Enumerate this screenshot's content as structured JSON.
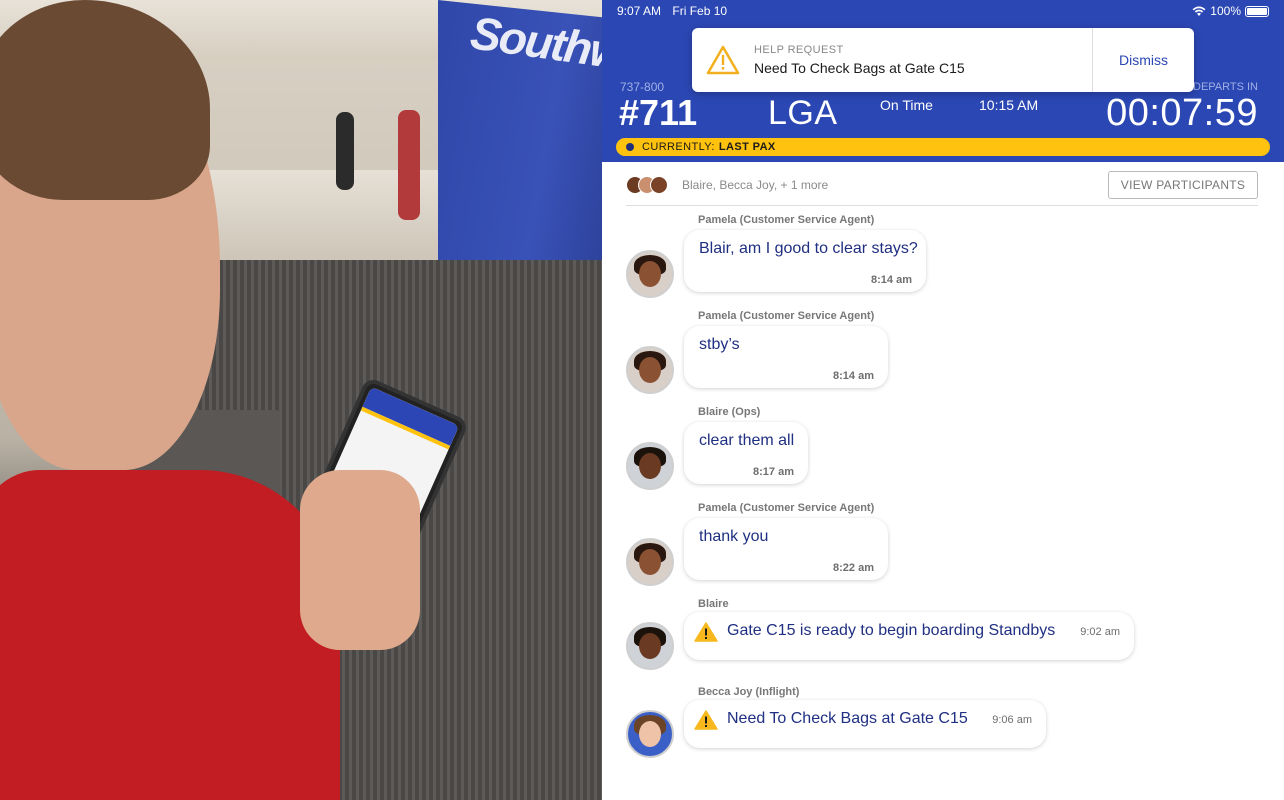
{
  "status_bar": {
    "time": "9:07 AM",
    "date": "Fri Feb 10",
    "battery": "100%"
  },
  "notification": {
    "kind": "HELP REQUEST",
    "message": "Need To Check Bags at Gate C15",
    "dismiss_label": "Dismiss",
    "icon": "warning-icon"
  },
  "flight": {
    "aircraft": "737-800",
    "number": "#711",
    "destination": "LGA",
    "status": "On Time",
    "departure_time": "10:15 AM",
    "departs_label": "DEPARTS IN",
    "countdown": "00:07:59"
  },
  "current": {
    "label": "CURRENTLY:",
    "value": "LAST PAX"
  },
  "participants": {
    "names": "Blaire, Becca Joy, + 1 more",
    "view_label": "VIEW PARTICIPANTS"
  },
  "messages": [
    {
      "sender": "Pamela (Customer Service Agent)",
      "text": "Blair, am I good to clear stays?",
      "time": "8:14 am",
      "alert": false
    },
    {
      "sender": "Pamela (Customer Service Agent)",
      "text": "stby’s",
      "time": "8:14 am",
      "alert": false
    },
    {
      "sender": "Blaire (Ops)",
      "text": "clear them all",
      "time": "8:17 am",
      "alert": false
    },
    {
      "sender": "Pamela (Customer Service Agent)",
      "text": "thank you",
      "time": "8:22 am",
      "alert": false
    },
    {
      "sender": "Blaire",
      "text": "Gate C15 is ready to begin boarding Standbys",
      "time": "9:02 am",
      "alert": true
    },
    {
      "sender": "Becca Joy (Inflight)",
      "text": "Need To Check Bags at Gate C15",
      "time": "9:06 am",
      "alert": true
    }
  ],
  "photo": {
    "sign_text": "Southwest"
  },
  "colors": {
    "brand_blue": "#2b47b3",
    "accent_yellow": "#ffc20e",
    "message_text": "#1f2f82"
  }
}
